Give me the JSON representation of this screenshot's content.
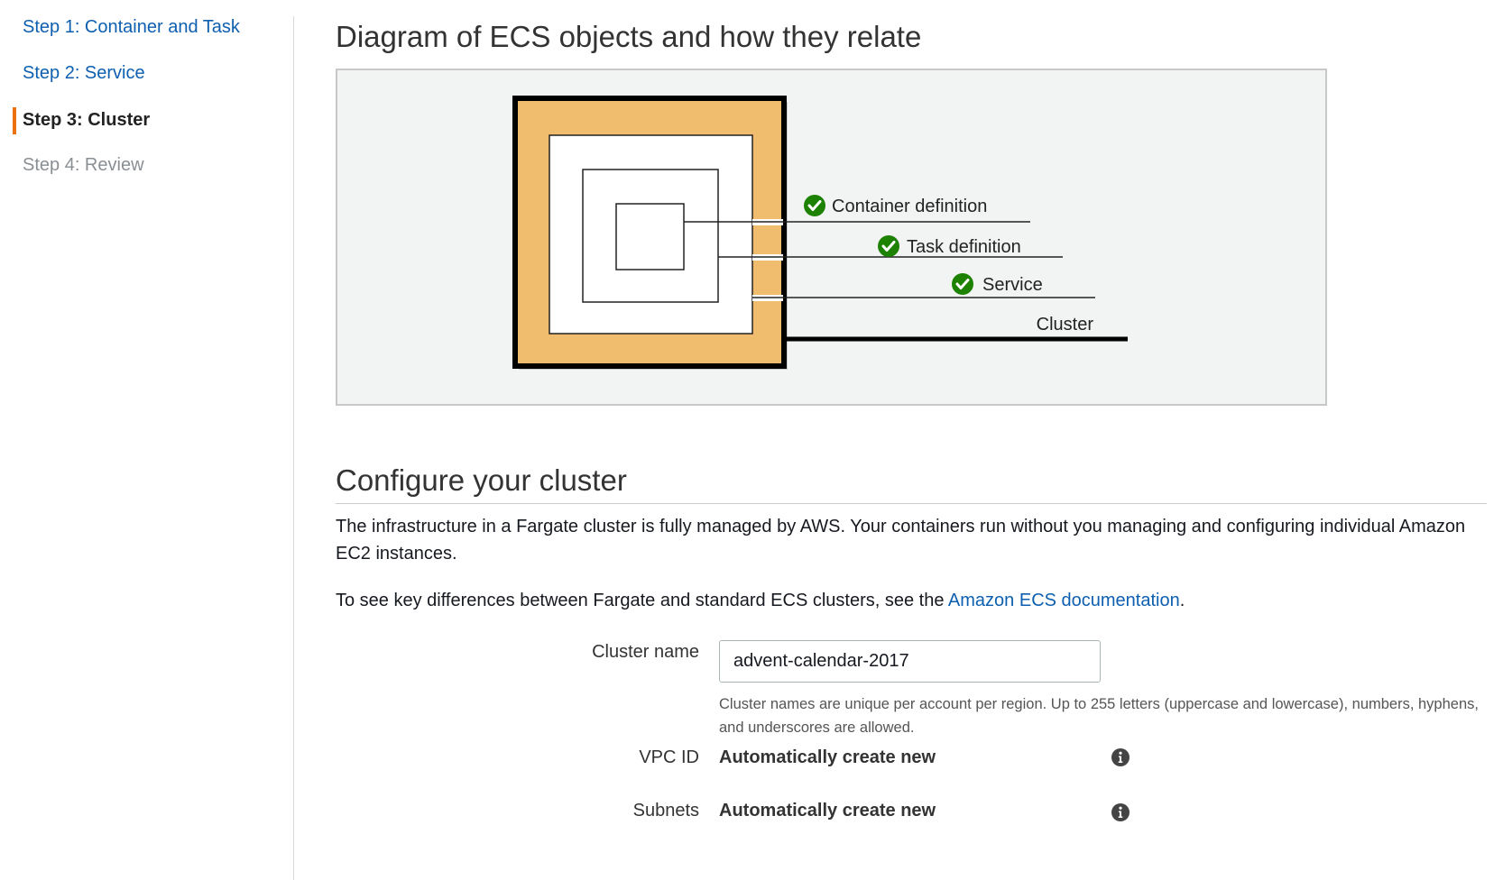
{
  "sidebar": {
    "steps": [
      {
        "label": "Step 1: Container and Task",
        "state": "link"
      },
      {
        "label": "Step 2: Service",
        "state": "link"
      },
      {
        "label": "Step 3: Cluster",
        "state": "active"
      },
      {
        "label": "Step 4: Review",
        "state": "disabled"
      }
    ],
    "accent_color": "#ec7211"
  },
  "diagram": {
    "title": "Diagram of ECS objects and how they relate",
    "labels": {
      "container_definition": "Container definition",
      "task_definition": "Task definition",
      "service": "Service",
      "cluster": "Cluster"
    },
    "check_icon": "check-circle-icon",
    "cluster_fill_color": "#f0bd6f",
    "check_color": "#1d8102"
  },
  "configure": {
    "heading": "Configure your cluster",
    "paragraph1": "The infrastructure in a Fargate cluster is fully managed by AWS. Your containers run without you managing and configuring individual Amazon EC2 instances.",
    "paragraph2_prefix": "To see key differences between Fargate and standard ECS clusters, see the ",
    "paragraph2_link": "Amazon ECS documentation",
    "paragraph2_suffix": ".",
    "cluster_name": {
      "label": "Cluster name",
      "value": "advent-calendar-2017",
      "help": "Cluster names are unique per account per region. Up to 255 letters (uppercase and lowercase), numbers, hyphens, and underscores are allowed."
    },
    "vpc_id": {
      "label": "VPC ID",
      "value": "Automatically create new",
      "icon": "info-icon"
    },
    "subnets": {
      "label": "Subnets",
      "value": "Automatically create new",
      "icon": "info-icon"
    }
  }
}
